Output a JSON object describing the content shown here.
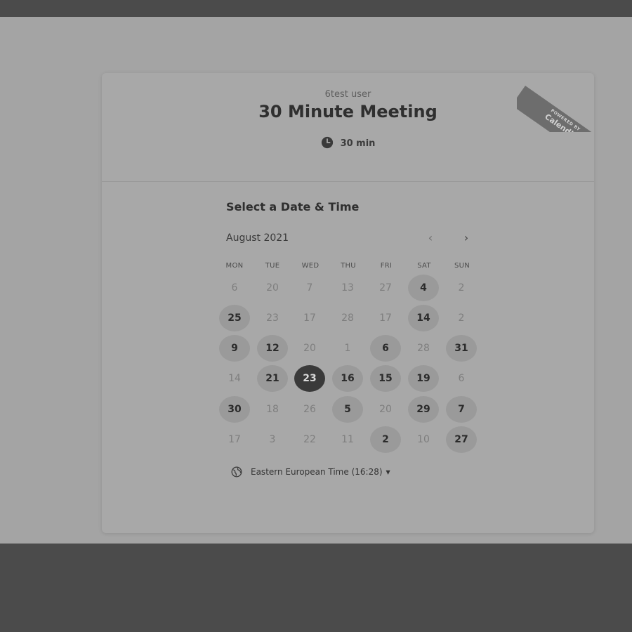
{
  "card": {
    "owner": "6test user",
    "title": "30 Minute Meeting",
    "duration": "30 min",
    "duration_icon": "clock-icon",
    "ribbon": {
      "powered_by": "POWERED BY",
      "brand": "Calendly"
    }
  },
  "calendar": {
    "heading": "Select a Date & Time",
    "month": "August 2021",
    "prev_label": "‹",
    "next_label": "›",
    "weekdays": [
      "MON",
      "TUE",
      "WED",
      "THU",
      "FRI",
      "SAT",
      "SUN"
    ],
    "weeks": [
      [
        {
          "d": "6",
          "s": "off"
        },
        {
          "d": "20",
          "s": "off"
        },
        {
          "d": "7",
          "s": "off"
        },
        {
          "d": "13",
          "s": "off"
        },
        {
          "d": "27",
          "s": "off"
        },
        {
          "d": "4",
          "s": "avail"
        },
        {
          "d": "2",
          "s": "off"
        }
      ],
      [
        {
          "d": "25",
          "s": "avail"
        },
        {
          "d": "23",
          "s": "off"
        },
        {
          "d": "17",
          "s": "off"
        },
        {
          "d": "28",
          "s": "off"
        },
        {
          "d": "17",
          "s": "off"
        },
        {
          "d": "14",
          "s": "avail"
        },
        {
          "d": "2",
          "s": "off"
        }
      ],
      [
        {
          "d": "9",
          "s": "avail"
        },
        {
          "d": "12",
          "s": "avail"
        },
        {
          "d": "20",
          "s": "off"
        },
        {
          "d": "1",
          "s": "off"
        },
        {
          "d": "6",
          "s": "avail"
        },
        {
          "d": "28",
          "s": "off"
        },
        {
          "d": "31",
          "s": "avail"
        }
      ],
      [
        {
          "d": "14",
          "s": "off"
        },
        {
          "d": "21",
          "s": "avail"
        },
        {
          "d": "23",
          "s": "selected"
        },
        {
          "d": "16",
          "s": "avail"
        },
        {
          "d": "15",
          "s": "avail"
        },
        {
          "d": "19",
          "s": "avail"
        },
        {
          "d": "6",
          "s": "off"
        }
      ],
      [
        {
          "d": "30",
          "s": "avail"
        },
        {
          "d": "18",
          "s": "off"
        },
        {
          "d": "26",
          "s": "off"
        },
        {
          "d": "5",
          "s": "avail"
        },
        {
          "d": "20",
          "s": "off"
        },
        {
          "d": "29",
          "s": "avail"
        },
        {
          "d": "7",
          "s": "avail"
        }
      ],
      [
        {
          "d": "17",
          "s": "off"
        },
        {
          "d": "3",
          "s": "off"
        },
        {
          "d": "22",
          "s": "off"
        },
        {
          "d": "11",
          "s": "off"
        },
        {
          "d": "2",
          "s": "avail"
        },
        {
          "d": "10",
          "s": "off"
        },
        {
          "d": "27",
          "s": "avail"
        }
      ]
    ]
  },
  "timezone": {
    "label": "Eastern European Time (16:28)",
    "icon": "globe-icon",
    "caret": "▼"
  },
  "colors": {
    "page_bg": "#a4a4a4",
    "dark_bg": "#4b4b4b",
    "selected": "#3a3a3a",
    "available": "#9a9a9a"
  }
}
